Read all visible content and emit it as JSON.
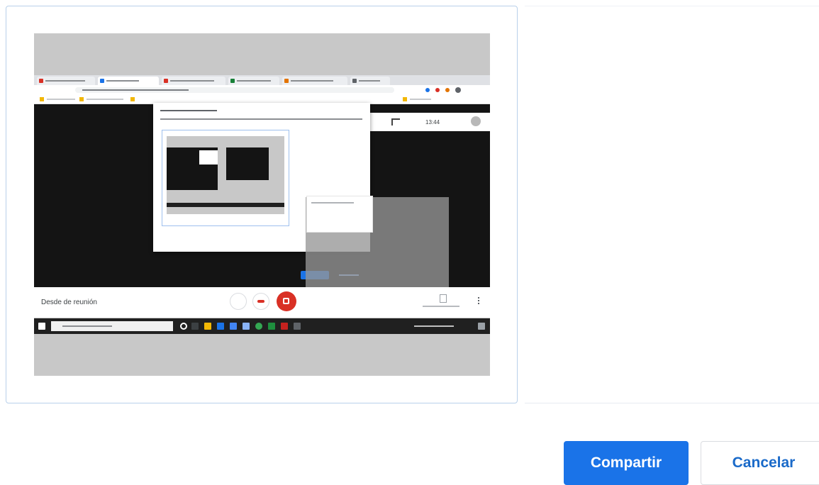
{
  "preview": {
    "meet_status": "Desde de reunión",
    "time": "13:44"
  },
  "actions": {
    "share_label": "Compartir",
    "cancel_label": "Cancelar"
  },
  "colors": {
    "primary": "#1a73e8",
    "card_border": "#b8d0ea",
    "end_call": "#d93025"
  }
}
